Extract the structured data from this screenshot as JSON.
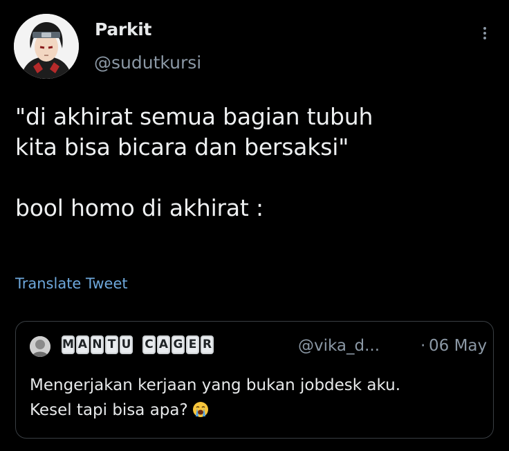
{
  "tweet": {
    "display_name": "Parkit",
    "handle": "@sudutkursi",
    "avatar_icon": "anime-avatar",
    "more_icon": "more-vertical-icon",
    "text": "\"di akhirat semua bagian tubuh\nkita bisa bicara dan bersaksi\"\n\nbool homo di akhirat :",
    "translate_label": "Translate Tweet"
  },
  "quote": {
    "name_letters": [
      "M",
      "A",
      "N",
      "T",
      "U",
      "",
      "C",
      "A",
      "G",
      "E",
      "R"
    ],
    "handle": "@vika_d...",
    "separator": "·",
    "date": "06 May",
    "text": "Mengerjakan kerjaan yang bukan jobdesk aku.\nKesel tapi bisa apa?",
    "emoji": "crying-face-emoji"
  },
  "colors": {
    "background": "#000000",
    "text": "#e7e9ea",
    "secondary": "#8b98a5",
    "link": "#6ea8dc",
    "border": "#3a3f44"
  }
}
